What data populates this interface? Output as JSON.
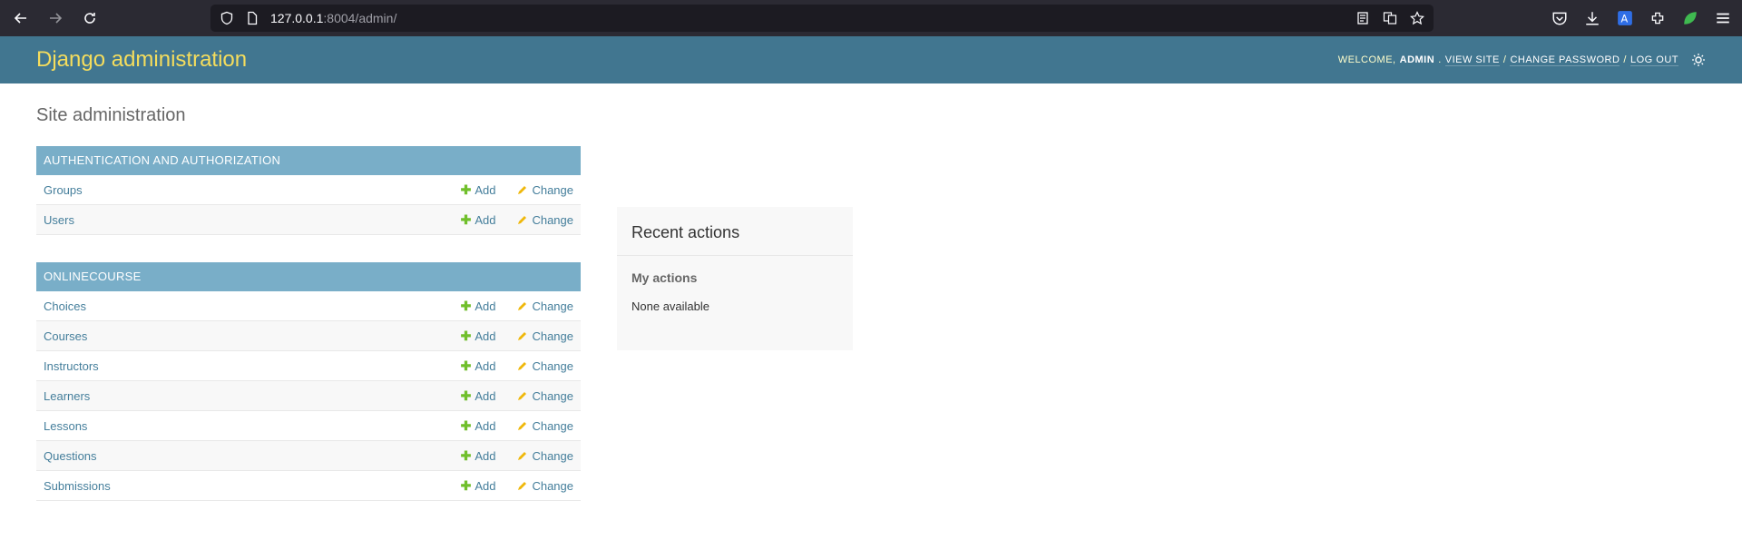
{
  "browser": {
    "url_host": "127.0.0.1",
    "url_rest": ":8004/admin/"
  },
  "header": {
    "branding": "Django administration",
    "welcome": "WELCOME,",
    "user": "ADMIN",
    "view_site": "VIEW SITE",
    "change_password": "CHANGE PASSWORD",
    "log_out": "LOG OUT",
    "sep": "/"
  },
  "page_title": "Site administration",
  "modules": [
    {
      "caption": "AUTHENTICATION AND AUTHORIZATION",
      "models": [
        "Groups",
        "Users"
      ]
    },
    {
      "caption": "ONLINECOURSE",
      "models": [
        "Choices",
        "Courses",
        "Instructors",
        "Learners",
        "Lessons",
        "Questions",
        "Submissions"
      ]
    }
  ],
  "labels": {
    "add": "Add",
    "change": "Change"
  },
  "recent": {
    "title": "Recent actions",
    "subtitle": "My actions",
    "none": "None available"
  },
  "colors": {
    "header_bg": "#417690",
    "branding": "#f5dd5d",
    "caption_bg": "#79aec8",
    "link": "#447e9b",
    "add_icon": "#70bf2b",
    "change_icon": "#efb80b"
  }
}
